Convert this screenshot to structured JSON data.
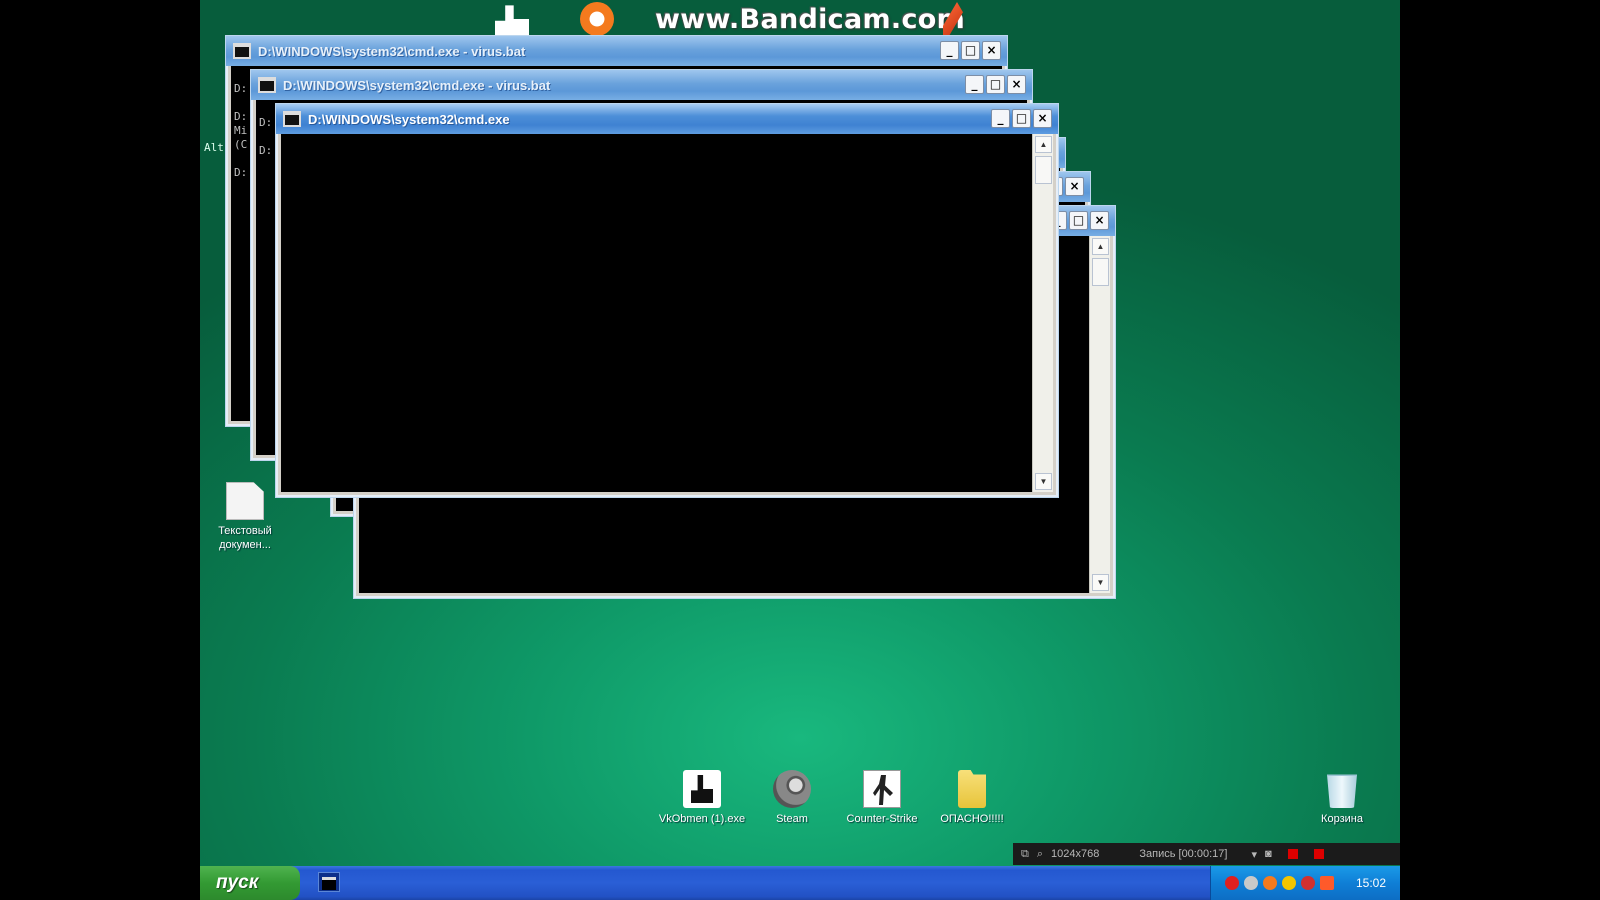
{
  "watermark": {
    "text": "www.Bandicam.com"
  },
  "windows": [
    {
      "title": "D:\\WINDOWS\\system32\\cmd.exe - virus.bat",
      "min": "_",
      "max": "□",
      "close": "×",
      "prompts": [
        "D:",
        "D:",
        "Mi",
        "(C",
        "D:"
      ]
    },
    {
      "title": "D:\\WINDOWS\\system32\\cmd.exe - virus.bat",
      "min": "_",
      "max": "□",
      "close": "×",
      "prompts": [
        "D:",
        "D:"
      ]
    },
    {
      "title": "D:\\WINDOWS\\system32\\cmd.exe",
      "min": "_",
      "max": "□",
      "close": "×"
    }
  ],
  "background_windows": {
    "close": "×",
    "max": "□",
    "min": "_"
  },
  "desktop": {
    "left_label": "Alt",
    "icons": [
      {
        "label": "Текстовый докумен..."
      },
      {
        "label": "VkObmen (1).exe"
      },
      {
        "label": "Steam"
      },
      {
        "label": "Counter-Strike"
      },
      {
        "label": "ОПАСНО!!!!!"
      },
      {
        "label": "Корзина"
      }
    ]
  },
  "bandicam_bar": {
    "resolution": "1024x768",
    "record": "Запись [00:00:17]"
  },
  "taskbar": {
    "start": "пуск",
    "clock": "15:02"
  },
  "colors": {
    "desktop": "#0f9a68",
    "taskbar": "#2458d0",
    "start": "#339a33"
  }
}
